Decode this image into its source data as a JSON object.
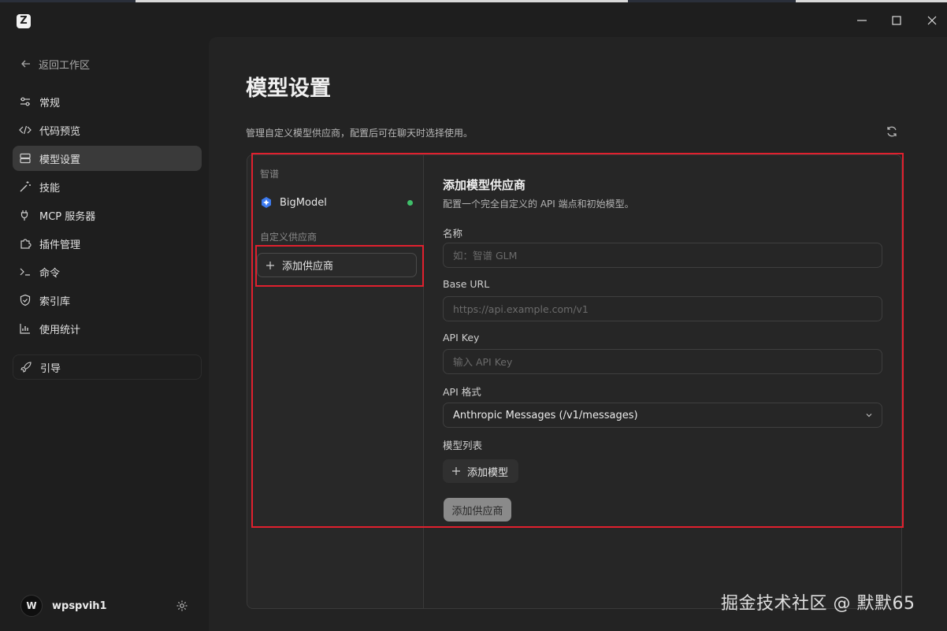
{
  "window": {
    "logo_letter": "Z",
    "minimize_icon": "minimize-icon",
    "maximize_icon": "maximize-icon",
    "close_icon": "close-icon"
  },
  "sidebar": {
    "back_label": "返回工作区",
    "items": [
      {
        "label": "常规",
        "icon": "sliders-icon",
        "active": false
      },
      {
        "label": "代码预览",
        "icon": "code-icon",
        "active": false
      },
      {
        "label": "模型设置",
        "icon": "server-icon",
        "active": true
      },
      {
        "label": "技能",
        "icon": "magic-wand-icon",
        "active": false
      },
      {
        "label": "MCP 服务器",
        "icon": "plug-icon",
        "active": false
      },
      {
        "label": "插件管理",
        "icon": "puzzle-icon",
        "active": false
      },
      {
        "label": "命令",
        "icon": "terminal-icon",
        "active": false
      },
      {
        "label": "索引库",
        "icon": "shield-icon",
        "active": false
      },
      {
        "label": "使用统计",
        "icon": "chart-icon",
        "active": false
      }
    ],
    "guide_label": "引导",
    "user": {
      "avatar_letter": "W",
      "name": "wpspvih1"
    }
  },
  "main": {
    "title": "模型设置",
    "description": "管理自定义模型供应商，配置后可在聊天时选择使用。"
  },
  "providers": {
    "group_builtin": "智谱",
    "builtin_items": [
      {
        "name": "BigModel",
        "status_color": "#3fbf6a"
      }
    ],
    "group_custom": "自定义供应商",
    "add_provider_label": "添加供应商"
  },
  "form": {
    "title": "添加模型供应商",
    "subtitle": "配置一个完全自定义的 API 端点和初始模型。",
    "name_label": "名称",
    "name_placeholder": "如：智谱 GLM",
    "base_url_label": "Base URL",
    "base_url_placeholder": "https://api.example.com/v1",
    "api_key_label": "API Key",
    "api_key_placeholder": "输入 API Key",
    "api_format_label": "API 格式",
    "api_format_value": "Anthropic Messages (/v1/messages)",
    "model_list_label": "模型列表",
    "add_model_label": "添加模型",
    "submit_label": "添加供应商"
  },
  "watermark": "掘金技术社区 @ 默默65",
  "colors": {
    "accent_red": "#e0202e",
    "status_green": "#3fbf6a"
  }
}
